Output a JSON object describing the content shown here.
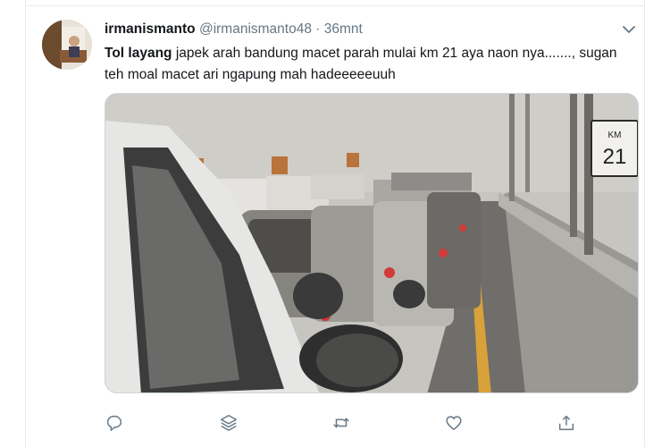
{
  "tweet": {
    "author_name": "irmanismanto",
    "author_handle": "@irmanismanto48",
    "separator": "·",
    "time": "36mnt",
    "text_bold": "Tol layang",
    "text_rest": " japek arah bandung macet parah mulai km 21 aya naon nya.......,  sugan teh moal macet ari  ngapung mah hadeeeeeuuh",
    "image": {
      "sign_line1": "KM",
      "sign_line2": "21"
    }
  },
  "actions": {
    "icons": [
      "reply-icon",
      "layers-icon",
      "retweet-icon",
      "like-icon",
      "share-icon"
    ]
  },
  "colors": {
    "text": "#14171a",
    "muted": "#657786",
    "border": "#e6ecf0"
  }
}
